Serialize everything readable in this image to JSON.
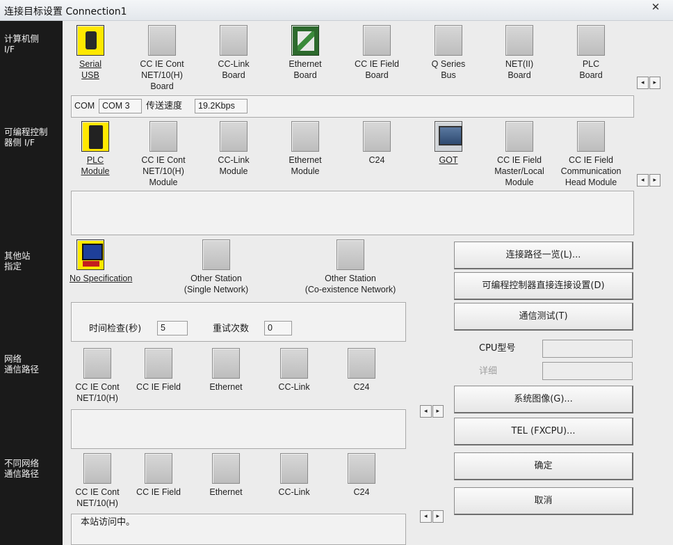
{
  "window": {
    "title": "连接目标设置 Connection1",
    "close_glyph": "✕"
  },
  "side_labels": {
    "pc_if": "计算机侧\nI/F",
    "plc_if": "可编程控制\n器侧 I/F",
    "other_station": "其他站\n指定",
    "network_route": "网络\n通信路径",
    "diff_network_route": "不同网络\n通信路径"
  },
  "pc_side": {
    "items": [
      {
        "label": "Serial\nUSB",
        "selected": true,
        "icon": "serial-usb-icon"
      },
      {
        "label": "CC IE Cont\nNET/10(H)\nBoard",
        "selected": false,
        "icon": "cc-ie-cont-board-icon"
      },
      {
        "label": "CC-Link\nBoard",
        "selected": false,
        "icon": "cc-link-board-icon"
      },
      {
        "label": "Ethernet\nBoard",
        "selected": false,
        "icon": "ethernet-board-icon"
      },
      {
        "label": "CC IE Field\nBoard",
        "selected": false,
        "icon": "cc-ie-field-board-icon"
      },
      {
        "label": "Q Series\nBus",
        "selected": false,
        "icon": "q-series-bus-icon"
      },
      {
        "label": "NET(II)\nBoard",
        "selected": false,
        "icon": "net-ii-board-icon"
      },
      {
        "label": "PLC\nBoard",
        "selected": false,
        "icon": "plc-board-icon"
      }
    ],
    "com_label": "COM",
    "com_value": "COM 3",
    "speed_label": "传送速度",
    "speed_value": "19.2Kbps"
  },
  "plc_side": {
    "items": [
      {
        "label": "PLC\nModule",
        "selected": true,
        "icon": "plc-module-icon"
      },
      {
        "label": "CC IE Cont\nNET/10(H)\nModule",
        "selected": false,
        "icon": "cc-ie-cont-module-icon"
      },
      {
        "label": "CC-Link\nModule",
        "selected": false,
        "icon": "cc-link-module-icon"
      },
      {
        "label": "Ethernet\nModule",
        "selected": false,
        "icon": "ethernet-module-icon"
      },
      {
        "label": "C24",
        "selected": false,
        "icon": "c24-icon"
      },
      {
        "label": "GOT",
        "selected": true,
        "icon": "got-icon"
      },
      {
        "label": "CC IE Field\nMaster/Local\nModule",
        "selected": false,
        "icon": "cc-ie-field-master-icon"
      },
      {
        "label": "CC IE Field\nCommunication\nHead Module",
        "selected": false,
        "icon": "cc-ie-field-head-icon"
      }
    ]
  },
  "other_station": {
    "items": [
      {
        "label": "No Specification",
        "selected": true,
        "icon": "no-specification-icon"
      },
      {
        "label": "Other Station\n(Single Network)",
        "selected": false,
        "icon": "other-station-single-icon"
      },
      {
        "label": "Other Station\n(Co-existence Network)",
        "selected": false,
        "icon": "other-station-coexist-icon"
      }
    ],
    "timeout_label": "时间检查(秒)",
    "timeout_value": "5",
    "retry_label": "重试次数",
    "retry_value": "0"
  },
  "network_route": {
    "items": [
      {
        "label": "CC IE Cont\nNET/10(H)"
      },
      {
        "label": "CC IE Field"
      },
      {
        "label": "Ethernet"
      },
      {
        "label": "CC-Link"
      },
      {
        "label": "C24"
      }
    ]
  },
  "diff_network_route": {
    "items": [
      {
        "label": "CC IE Cont\nNET/10(H)"
      },
      {
        "label": "CC IE Field"
      },
      {
        "label": "Ethernet"
      },
      {
        "label": "CC-Link"
      },
      {
        "label": "C24"
      }
    ],
    "status_text": "本站访问中。"
  },
  "scroll": {
    "left": "◂",
    "right": "▸"
  },
  "buttons": {
    "route_list": "连接路径一览(L)...",
    "plc_direct": "可编程控制器直接连接设置(D)",
    "comm_test": "通信测试(T)",
    "system_image": "系统图像(G)...",
    "tel": "TEL (FXCPU)...",
    "ok": "确定",
    "cancel": "取消"
  },
  "cpu": {
    "model_label": "CPU型号",
    "model_value": "",
    "detail_label": "详细",
    "detail_value": ""
  }
}
